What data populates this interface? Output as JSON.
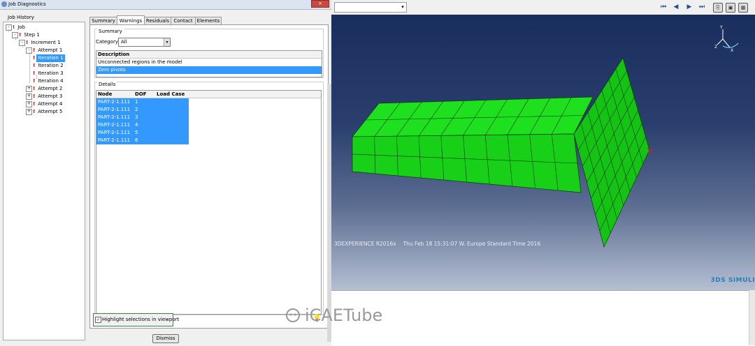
{
  "dialog": {
    "title": "Job Diagnostics",
    "close_label": "×",
    "job_history_label": "Job History",
    "tree": [
      {
        "label": "Job",
        "toggle": "-",
        "level": 0
      },
      {
        "label": "Step 1",
        "toggle": "-",
        "level": 1
      },
      {
        "label": "Increment 1",
        "toggle": "-",
        "level": 2
      },
      {
        "label": "Attempt 1",
        "toggle": "-",
        "level": 3
      },
      {
        "label": "Iteration 1",
        "toggle": "",
        "level": 4,
        "selected": true
      },
      {
        "label": "Iteration 2",
        "toggle": "",
        "level": 4
      },
      {
        "label": "Iteration 3",
        "toggle": "",
        "level": 4
      },
      {
        "label": "Iteration 4",
        "toggle": "",
        "level": 4
      },
      {
        "label": "Attempt 2",
        "toggle": "+",
        "level": 3
      },
      {
        "label": "Attempt 3",
        "toggle": "+",
        "level": 3
      },
      {
        "label": "Attempt 4",
        "toggle": "+",
        "level": 3
      },
      {
        "label": "Attempt 5",
        "toggle": "+",
        "level": 3
      }
    ],
    "tabs": [
      "Summary",
      "Warnings",
      "Residuals",
      "Contact",
      "Elements"
    ],
    "active_tab": "Warnings",
    "summary": {
      "group_label": "Summary",
      "category_label": "Category:",
      "category_value": "All",
      "table_header": "Description",
      "rows": [
        "Unconnected regions in the model",
        "Zero pivots"
      ],
      "selected_row": "Zero pivots"
    },
    "details": {
      "group_label": "Details",
      "headers": {
        "node": "Node",
        "dof": "DOF",
        "load_case": "Load Case"
      },
      "rows": [
        {
          "node": "PART-2-1.111",
          "dof": "1",
          "load_case": ""
        },
        {
          "node": "PART-2-1.111",
          "dof": "2",
          "load_case": ""
        },
        {
          "node": "PART-2-1.111",
          "dof": "3",
          "load_case": ""
        },
        {
          "node": "PART-2-1.111",
          "dof": "4",
          "load_case": ""
        },
        {
          "node": "PART-2-1.111",
          "dof": "5",
          "load_case": ""
        },
        {
          "node": "PART-2-1.111",
          "dof": "6",
          "load_case": ""
        }
      ]
    },
    "highlight_checkbox": {
      "label": "Highlight selections in viewport",
      "checked": true,
      "check_glyph": "✓"
    },
    "dismiss_label": "Dismiss"
  },
  "main_window": {
    "toolbar": {
      "icons": [
        "first-frame-icon",
        "previous-frame-icon",
        "next-frame-icon",
        "last-frame-icon",
        "camera-icon",
        "print-icon",
        "image-icon"
      ],
      "glyphs": {
        "first": "⏮",
        "prev": "◀",
        "next": "▶",
        "last": "⏭",
        "a": "⎘",
        "b": "▣",
        "c": "▦",
        "combo_arrow": "▾"
      }
    },
    "viewport": {
      "stamp_product": "3DEXPERIENCE R2016x",
      "stamp_date": "Thu Feb 18 15:31:07 W. Europe Standard Time 2016",
      "triad_labels": {
        "y": "Y",
        "x": "X",
        "z": "Z"
      },
      "model_color": "#18d018",
      "background_top": "#1a2e5d",
      "background_bottom": "#b4bfd2"
    },
    "brand": "3DS SIMULI",
    "watermark": "iCAETube"
  },
  "colors": {
    "selection": "#3399ff",
    "warning_mark": "#c00000",
    "highlight_border": "#2f8a3a"
  }
}
